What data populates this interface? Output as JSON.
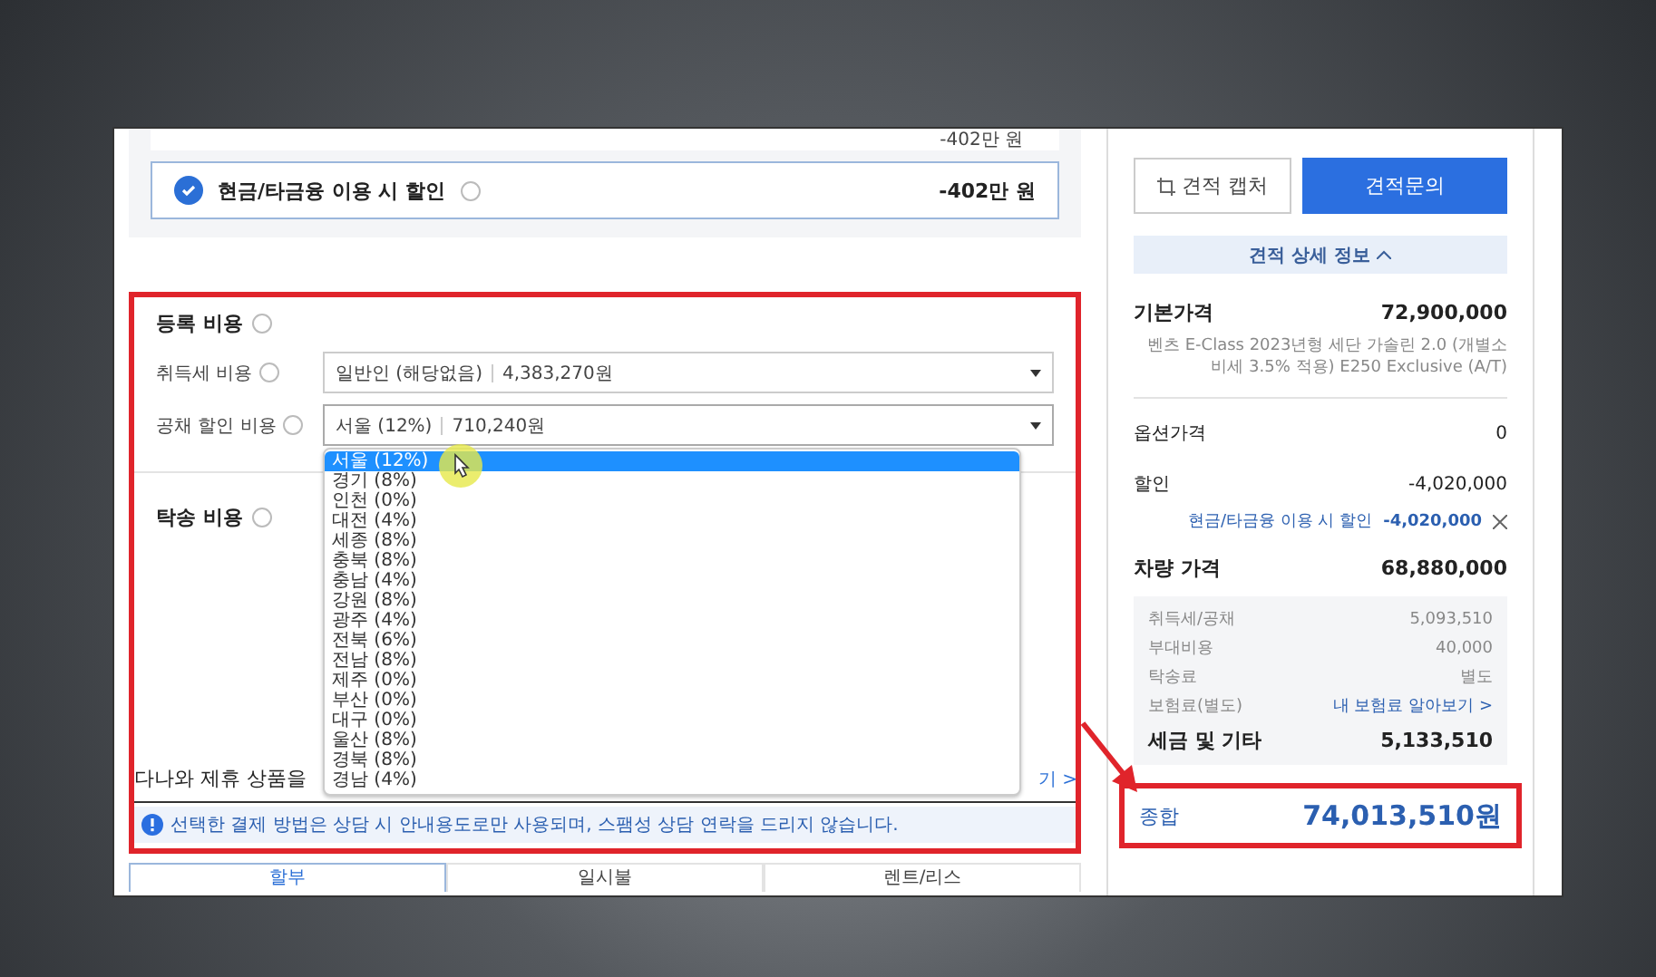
{
  "cut_row": {
    "amount": "-402만 원"
  },
  "discount_option": {
    "label": "현금/타금융 이용 시 할인",
    "amount": "-402만 원",
    "checked": true
  },
  "registration": {
    "title": "등록 비용",
    "fields": [
      {
        "label": "취득세 비용",
        "value": "일반인 (해당없음)",
        "amount": "4,383,270원",
        "open": false
      },
      {
        "label": "공채 할인 비용",
        "value": "서울 (12%)",
        "amount": "710,240원",
        "open": true
      }
    ],
    "dropdown": [
      {
        "label": "서울 (12%)",
        "selected": true
      },
      {
        "label": "경기 (8%)",
        "selected": false
      },
      {
        "label": "인천 (0%)",
        "selected": false
      },
      {
        "label": "대전 (4%)",
        "selected": false
      },
      {
        "label": "세종 (8%)",
        "selected": false
      },
      {
        "label": "충북 (8%)",
        "selected": false
      },
      {
        "label": "충남 (4%)",
        "selected": false
      },
      {
        "label": "강원 (8%)",
        "selected": false
      },
      {
        "label": "광주 (4%)",
        "selected": false
      },
      {
        "label": "전북 (6%)",
        "selected": false
      },
      {
        "label": "전남 (8%)",
        "selected": false
      },
      {
        "label": "제주 (0%)",
        "selected": false
      },
      {
        "label": "부산 (0%)",
        "selected": false
      },
      {
        "label": "대구 (0%)",
        "selected": false
      },
      {
        "label": "울산 (8%)",
        "selected": false
      },
      {
        "label": "경북 (8%)",
        "selected": false
      },
      {
        "label": "경남 (4%)",
        "selected": false
      }
    ]
  },
  "delivery": {
    "title": "탁송 비용"
  },
  "partner": {
    "title": "다나와 제휴 상품을",
    "link": "기 >"
  },
  "notice": "선택한 결제 방법은 상담 시 안내용도로만 사용되며, 스팸성 상담 연락을 드리지 않습니다.",
  "payment_tabs": [
    {
      "label": "할부",
      "selected": true
    },
    {
      "label": "일시불",
      "selected": false
    },
    {
      "label": "렌트/리스",
      "selected": false
    }
  ],
  "actions": [
    {
      "label": "견적 캡처",
      "kind": "outline"
    },
    {
      "label": "견적문의",
      "kind": "primary"
    }
  ],
  "details_toggle": {
    "label": "견적 상세 정보",
    "expanded": true
  },
  "base_price": {
    "label": "기본가격",
    "value": "72,900,000",
    "description": "벤츠 E-Class 2023년형 세단 가솔린 2.0 (개별소비세 3.5% 적용) E250 Exclusive (A/T)"
  },
  "option_price": {
    "label": "옵션가격",
    "value": "0"
  },
  "discount": {
    "label": "할인",
    "value": "-4,020,000",
    "items": [
      {
        "label": "현금/타금융 이용 시 할인",
        "value": "-4,020,000"
      }
    ]
  },
  "vehicle_price": {
    "label": "차량 가격",
    "value": "68,880,000"
  },
  "taxes": {
    "rows": [
      {
        "label": "취득세/공채",
        "value": "5,093,510",
        "kind": "plain"
      },
      {
        "label": "부대비용",
        "value": "40,000",
        "kind": "plain"
      },
      {
        "label": "탁송료",
        "value": "별도",
        "kind": "plain"
      },
      {
        "label": "보험료(별도)",
        "value": "내 보험료 알아보기 >",
        "kind": "link"
      }
    ],
    "total_label": "세금 및 기타",
    "total": "5,133,510"
  },
  "grand_total": {
    "label": "종합",
    "value": "74,013,510원"
  }
}
